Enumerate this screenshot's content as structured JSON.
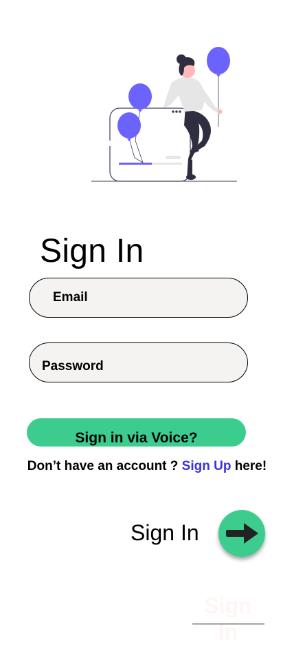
{
  "page": {
    "title": "Sign In"
  },
  "form": {
    "email": {
      "placeholder": "Email",
      "value": ""
    },
    "password": {
      "placeholder": "Password",
      "value": ""
    }
  },
  "voice_button": {
    "label": "Sign in via Voice?"
  },
  "signup_prompt": {
    "prefix": "Don’t have an account ? ",
    "link": "Sign Up",
    "suffix": " here!"
  },
  "submit": {
    "label": "Sign In",
    "icon": "arrow-right-icon"
  },
  "footer": {
    "ghost_label": "Sign In"
  },
  "colors": {
    "accent_green": "#3ccd8e",
    "link_blue": "#3a33d8",
    "balloon_purple": "#6c63ff",
    "field_bg": "#f5f3f1",
    "ghost_text": "#fff5f4"
  }
}
